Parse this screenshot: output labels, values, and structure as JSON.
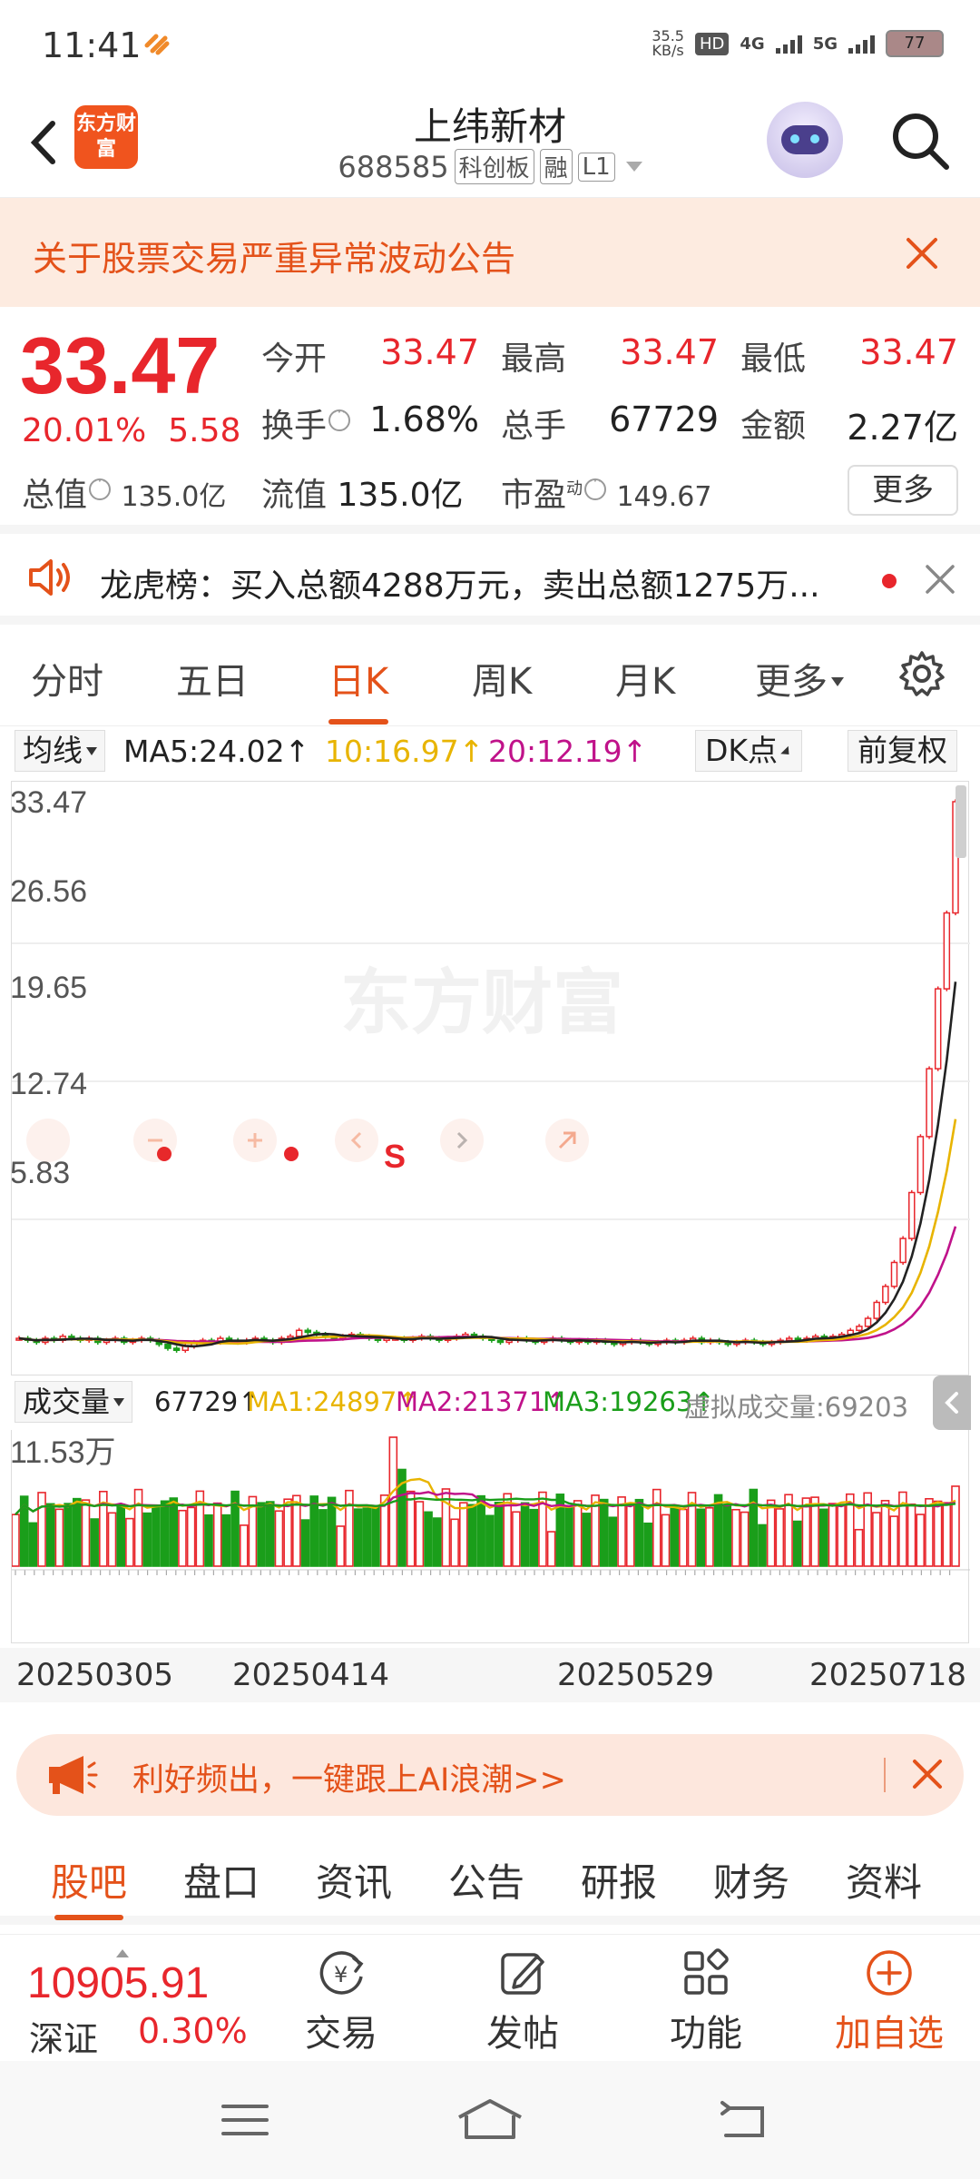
{
  "status_bar": {
    "time": "11:41",
    "net_speed": "35.5",
    "net_unit": "KB/s",
    "hd": "HD",
    "sig1": "4G",
    "sig2": "5G",
    "battery": "77"
  },
  "header": {
    "logo_text": "东方财富",
    "title": "上纬新材",
    "code": "688585",
    "tags": [
      "科创板",
      "融",
      "L1"
    ]
  },
  "notice": {
    "text": "关于股票交易严重异常波动公告"
  },
  "quote": {
    "price": "33.47",
    "change_pct": "20.01%",
    "change": "5.58",
    "open_label": "今开",
    "open": "33.47",
    "high_label": "最高",
    "high": "33.47",
    "low_label": "最低",
    "low": "33.47",
    "turnover_label": "换手",
    "turnover": "1.68%",
    "volume_label": "总手",
    "volume": "67729",
    "amount_label": "金额",
    "amount": "2.27亿",
    "mktcap_label": "总值",
    "mktcap": "135.0亿",
    "float_label": "流值",
    "float": "135.0亿",
    "pe_label": "市盈",
    "pe_sup": "动",
    "pe": "149.67",
    "more": "更多"
  },
  "dragon": {
    "text": "龙虎榜：买入总额4288万元，卖出总额1275万..."
  },
  "k_tabs": [
    "分时",
    "五日",
    "日K",
    "周K",
    "月K",
    "更多"
  ],
  "k_active": "日K",
  "ma_row": {
    "selector": "均线",
    "ma5": "MA5:24.02↑",
    "ma10": "10:16.97↑",
    "ma20": "20:12.19↑",
    "dk": "DK点",
    "fq": "前复权"
  },
  "colors": {
    "red": "#e8262c",
    "green": "#1a9e1a",
    "ma5": "#222222",
    "ma10": "#e8b400",
    "ma20": "#c0128a",
    "ma3": "#1a9e1a",
    "accent": "#e4521a"
  },
  "chart_data": [
    {
      "type": "candlestick",
      "watermark": "东方财富",
      "y_ticks": [
        "33.47",
        "26.56",
        "19.65",
        "12.74",
        "5.83"
      ],
      "ylim": [
        5.83,
        33.47
      ],
      "x_ticks": [
        "20250305",
        "20250414",
        "20250529",
        "20250718"
      ],
      "series": [
        {
          "name": "MA5",
          "last": 24.02
        },
        {
          "name": "MA10",
          "last": 16.97
        },
        {
          "name": "MA20",
          "last": 12.19
        }
      ],
      "close": [
        6.6,
        6.5,
        6.4,
        6.6,
        6.5,
        6.7,
        6.6,
        6.5,
        6.6,
        6.4,
        6.5,
        6.6,
        6.4,
        6.5,
        6.6,
        6.5,
        6.3,
        6.1,
        6.0,
        6.2,
        6.4,
        6.5,
        6.4,
        6.6,
        6.5,
        6.4,
        6.5,
        6.6,
        6.5,
        6.4,
        6.6,
        6.7,
        7.0,
        6.9,
        6.8,
        6.7,
        6.6,
        6.7,
        6.8,
        6.7,
        6.6,
        6.5,
        6.6,
        6.6,
        6.5,
        6.6,
        6.7,
        6.6,
        6.5,
        6.6,
        6.7,
        6.8,
        6.7,
        6.6,
        6.5,
        6.4,
        6.5,
        6.6,
        6.5,
        6.4,
        6.5,
        6.6,
        6.5,
        6.4,
        6.5,
        6.4,
        6.5,
        6.4,
        6.3,
        6.4,
        6.5,
        6.4,
        6.3,
        6.4,
        6.5,
        6.4,
        6.5,
        6.6,
        6.4,
        6.5,
        6.4,
        6.3,
        6.4,
        6.5,
        6.4,
        6.3,
        6.4,
        6.5,
        6.6,
        6.5,
        6.6,
        6.7,
        6.6,
        6.7,
        6.8,
        7.0,
        7.2,
        7.6,
        8.4,
        9.2,
        10.4,
        11.6,
        13.9,
        16.7,
        20.1,
        24.1,
        27.9,
        33.47
      ]
    },
    {
      "type": "bar",
      "title": "成交量",
      "volume": "67729↑",
      "ma1": "MA1:24897↑",
      "ma2": "MA2:21371↑",
      "ma3": "MA3:19263↑",
      "virtual": "虚拟成交量:69203",
      "y_max_label": "11.53万"
    }
  ],
  "promo": {
    "text": "利好频出，一键跟上AI浪潮>>"
  },
  "bottom_tabs": [
    "股吧",
    "盘口",
    "资讯",
    "公告",
    "研报",
    "财务",
    "资料"
  ],
  "bottom_active": "股吧",
  "index": {
    "value": "10905.91",
    "name": "深证",
    "pct": "0.30%"
  },
  "actions": [
    {
      "label": "交易",
      "icon": "trade-icon"
    },
    {
      "label": "发帖",
      "icon": "post-icon"
    },
    {
      "label": "功能",
      "icon": "function-icon"
    },
    {
      "label": "加自选",
      "icon": "add-watch-icon"
    }
  ]
}
